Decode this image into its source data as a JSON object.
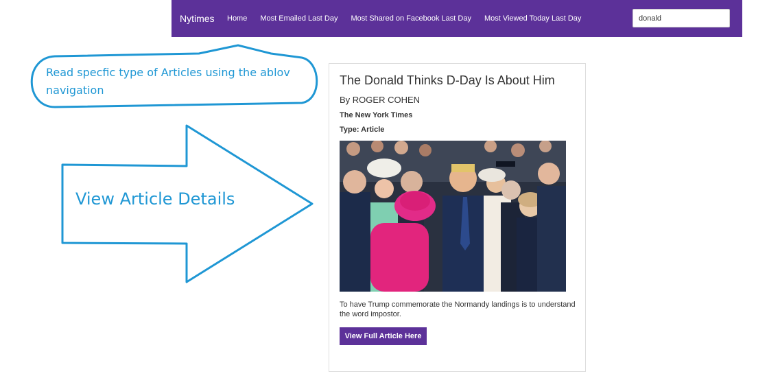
{
  "navbar": {
    "brand": "Nytimes",
    "links": [
      "Home",
      "Most Emailed Last Day",
      "Most Shared on Facebook Last Day",
      "Most Viewed Today Last Day"
    ],
    "search_value": "donald",
    "background_color": "#5c3199"
  },
  "annotations": {
    "callout_text": "Read specfic type of Articles using the ablov navigation",
    "arrow_text": "View Article Details",
    "color": "#1f97d4"
  },
  "article": {
    "title": "The Donald Thinks D-Day Is About Him",
    "byline": "By ROGER COHEN",
    "source": "The New York Times",
    "type": "Type: Article",
    "image_icon": "photo-dignitaries-crowd",
    "abstract": "To have Trump commemorate the Normandy landings is to understand the word impostor.",
    "button_label": "View Full Article Here",
    "button_color": "#5c3199"
  }
}
